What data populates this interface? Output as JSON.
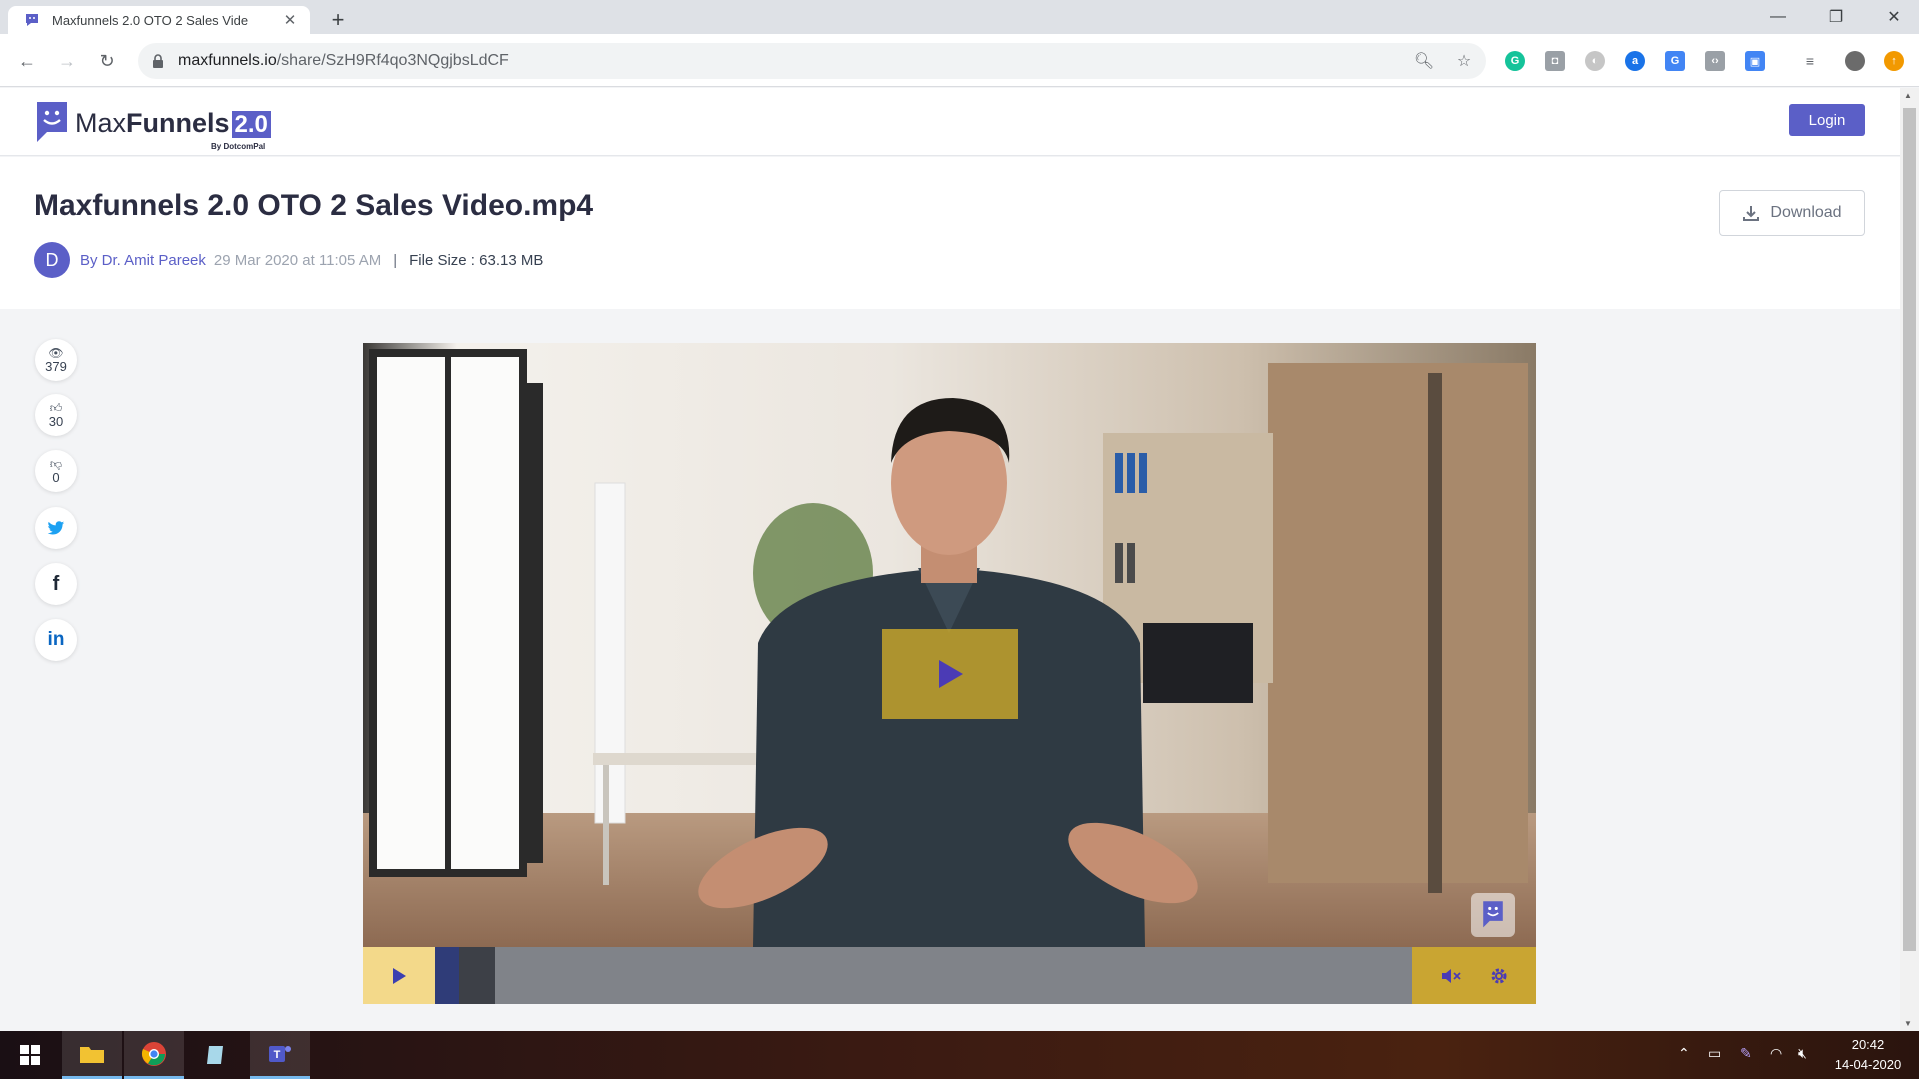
{
  "browser": {
    "tab_title": "Maxfunnels 2.0 OTO 2 Sales Vide",
    "url_host": "maxfunnels.io",
    "url_path": "/share/SzH9Rf4qo3NQgjbsLdCF"
  },
  "header": {
    "logo_max": "Max",
    "logo_funnels": "Funnels",
    "logo_version": "2.0",
    "logo_sub": "By DotcomPal",
    "login_label": "Login"
  },
  "video": {
    "title": "Maxfunnels 2.0 OTO 2 Sales Video.mp4",
    "avatar_letter": "D",
    "author": "By Dr. Amit Pareek",
    "date": "29 Mar 2020 at 11:05 AM",
    "separator": "|",
    "file_size": "File Size : 63.13 MB",
    "download_label": "Download",
    "progress_fraction": 0.02
  },
  "social": {
    "views": "379",
    "likes": "30",
    "dislikes": "0"
  },
  "taskbar": {
    "time": "20:42",
    "date": "14-04-2020"
  },
  "colors": {
    "brand": "#5b5fc7",
    "player_accent": "#c9a532"
  }
}
